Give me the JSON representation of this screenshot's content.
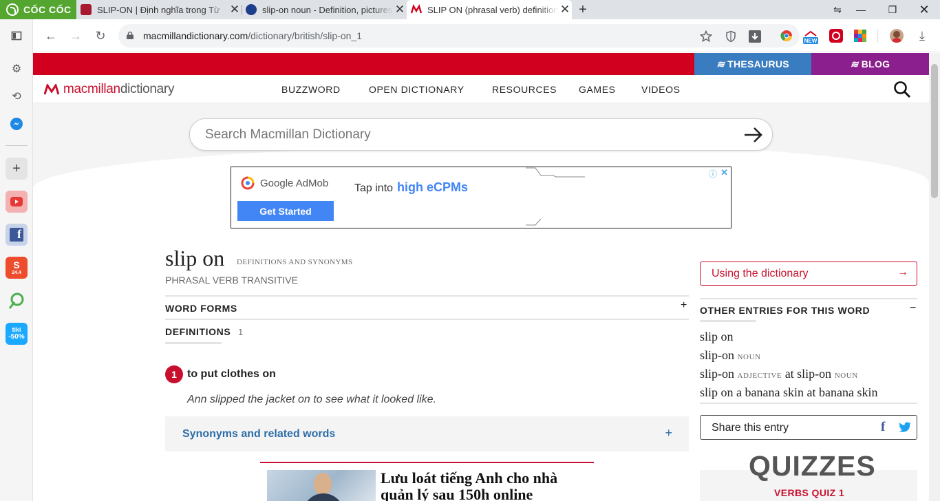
{
  "browser": {
    "brand": "CỐC CỐC",
    "tabs": [
      {
        "title": "SLIP-ON | Định nghĩa trong Từ",
        "favicon_color": "#a6192e"
      },
      {
        "title": "slip-on noun - Definition, pictures",
        "favicon_color": "#1d3e8a"
      },
      {
        "title": "SLIP ON (phrasal verb) definition",
        "favicon_color": "#d1001f"
      }
    ],
    "window_buttons": [
      "‒",
      "—",
      "❐",
      "✕"
    ],
    "url_domain": "macmillandictionary.com",
    "url_path": "/dictionary/british/slip-on_1"
  },
  "sidebar": {
    "apps": [
      {
        "name": "youtube",
        "color": "#e53935",
        "glyph": "▶"
      },
      {
        "name": "facebook",
        "color": "#3b5998",
        "glyph": "f"
      },
      {
        "name": "shopee",
        "color": "#ee4d2d",
        "glyph": "S"
      },
      {
        "name": "ecosia",
        "color": "#4caf50",
        "glyph": "✎"
      },
      {
        "name": "tiki",
        "color": "#1ba8ff",
        "glyph": "tiki"
      }
    ],
    "tiki_text": "tiki",
    "tiki_sale": "-50%",
    "shopee_date": "24.4"
  },
  "site": {
    "thesaurus": "THESAURUS",
    "blog": "BLOG",
    "logo_part1": "macmillan",
    "logo_part2": " dictionary",
    "nav": [
      "BUZZWORD",
      "OPEN DICTIONARY",
      "RESOURCES",
      "GAMES",
      "VIDEOS"
    ],
    "search_placeholder": "Search Macmillan Dictionary",
    "colors": {
      "red": "#d1001f",
      "thesaurus": "#3a7cc0",
      "blog": "#8b1f8d",
      "link": "#2f6ea8"
    }
  },
  "ad": {
    "brand": "Google AdMob",
    "cta": "Get Started",
    "tap": "Tap into",
    "highlight": "high eCPMs"
  },
  "entry": {
    "headword": "slip on",
    "subtitle": "DEFINITIONS AND SYNONYMS",
    "pos": "PHRASAL VERB",
    "grammar": "TRANSITIVE",
    "word_forms": "WORD FORMS",
    "definitions": "DEFINITIONS",
    "def_count": "1",
    "sense_number": "1",
    "sense_def": "to put clothes on",
    "example": "Ann slipped the jacket on to see what it looked like.",
    "synonyms": "Synonyms and related words"
  },
  "promo": {
    "title": "Lưu loát tiếng Anh cho nhà quản lý sau 150h online"
  },
  "right": {
    "using": "Using the dictionary",
    "other_heading": "OTHER ENTRIES FOR THIS WORD",
    "other_entries": [
      {
        "word": "slip on",
        "label": "",
        "extra": "",
        "extra_label": ""
      },
      {
        "word": "slip-on",
        "label": "NOUN",
        "extra": "",
        "extra_label": ""
      },
      {
        "word": "slip-on",
        "label": "ADJECTIVE",
        "extra": "at slip-on",
        "extra_label": "NOUN"
      },
      {
        "word": "slip on a banana skin",
        "label": "",
        "extra": "at banana skin",
        "extra_label": ""
      }
    ],
    "share": "Share this entry",
    "quizzes": "QUIZZES",
    "quiz_sub": "VERBS QUIZ 1"
  }
}
